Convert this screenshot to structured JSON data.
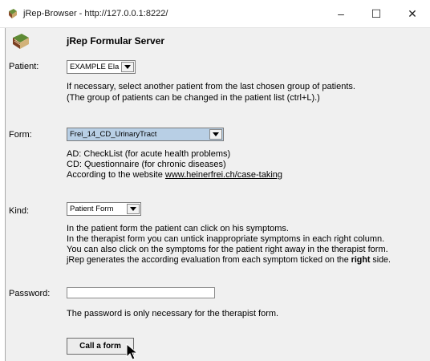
{
  "window": {
    "title": "jRep-Browser - http://127.0.0.1:8222/",
    "minimize": "–",
    "maximize": "☐",
    "close": "✕"
  },
  "header": {
    "title": "jRep Formular Server"
  },
  "patient": {
    "label": "Patient:",
    "selected": "EXAMPLE Ela",
    "help_line1": "If necessary, select another patient from the last chosen group of patients.",
    "help_line2": "(The group of patients can be changed in the patient list (ctrl+L).)"
  },
  "form": {
    "label": "Form:",
    "selected": "Frei_14_CD_UrinaryTract",
    "desc_line1": "AD: CheckList (for acute health problems)",
    "desc_line2": "CD: Questionnaire (for chronic diseases)",
    "desc_line3_prefix": "According to the website ",
    "desc_link": "www.heinerfrei.ch/case-taking"
  },
  "kind": {
    "label": "Kind:",
    "selected": "Patient Form",
    "line1": "In the patient form the patient can click on his symptoms.",
    "line2": "In the therapist form you can untick inappropriate symptoms in each right column.",
    "line3": "You can also click on the symptoms for the patient right away in the therapist form.",
    "line4_prefix": "jRep generates the according evaluation from each symptom ticked on the ",
    "line4_bold": "right",
    "line4_suffix": " side."
  },
  "password": {
    "label": "Password:",
    "value": "",
    "help": "The password is only necessary for the therapist form."
  },
  "call_button": {
    "label": "Call a form"
  },
  "colors": {
    "form_combo_selected_bg": "#b8cfe5",
    "panel_bg": "#f0f0f0"
  },
  "icons": {
    "app": "book-icon",
    "header": "books-icon",
    "pointer": "mouse-pointer-icon"
  }
}
